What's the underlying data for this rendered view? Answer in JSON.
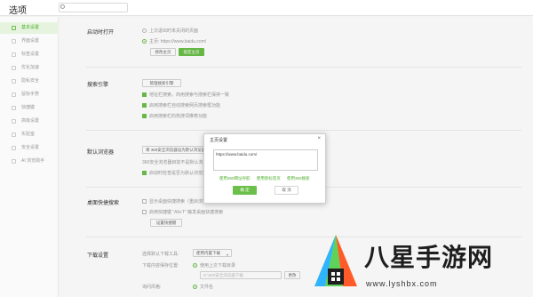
{
  "header": {
    "title": "选项",
    "search_placeholder": ""
  },
  "sidebar": {
    "items": [
      {
        "label": "基本设置"
      },
      {
        "label": "界面设置"
      },
      {
        "label": "标签设置"
      },
      {
        "label": "优化加速"
      },
      {
        "label": "隐私安全"
      },
      {
        "label": "鼠标手势"
      },
      {
        "label": "快捷键"
      },
      {
        "label": "高级设置"
      },
      {
        "label": "实验室"
      },
      {
        "label": "安全设置"
      },
      {
        "label": "AI 浏览助手"
      }
    ]
  },
  "startup": {
    "label": "启动时打开",
    "option1": "上次退出时未关闭的页面",
    "option2": "主页: https://www.baidu.com/",
    "btn_modify": "修改主页",
    "btn_lock": "锁定主页"
  },
  "search": {
    "label": "搜索引擎",
    "btn_manage": "管理搜索引擎",
    "opt1": "地址栏搜索，商用搜索与搜索栏保持一致",
    "opt2": "启用搜索栏自动搜索网页搜索框功能",
    "opt3": "启用搜索栏的热搜词推荐功能"
  },
  "default_browser": {
    "label": "默认浏览器",
    "select": "将 360安全浏览器设为默认浏览器",
    "line1": "360安全浏览器目前不是默认浏览器",
    "line2": "启动时检查是否为默认浏览器"
  },
  "desktop_search": {
    "label": "桌面快捷搜索",
    "opt1": "显示桌面快捷搜索（重启浏览器后生效）",
    "opt2": "启用快捷键 \"Alt+T\" 触发桌面快捷搜索",
    "btn": "设置快捷键"
  },
  "download": {
    "label": "下载设置",
    "tool_label": "选择默认下载工具:",
    "tool_value": "使用内置下载",
    "dir_label": "下载内容保存位置:",
    "dir_option": "使用上次下载目录",
    "path_value": "D:\\360安全浏览器下载",
    "btn_change": "更改",
    "ask_label": "询问风格:",
    "ask_option": "文件名"
  },
  "dialog": {
    "title": "主页设置",
    "close": "×",
    "url": "https://www.baidu.com/",
    "link1": "使用360网址导航",
    "link2": "使用新标签页",
    "link3": "使用360搜索",
    "ok": "确 定",
    "cancel": "取 消"
  },
  "watermark": {
    "brand": "八星手游网",
    "url": "www.lyshbx.com"
  },
  "colors": {
    "accent": "#6cbf4a",
    "sidebar_active_bg": "#e6f4df"
  },
  "icons": {
    "search": "search-icon",
    "close": "close-icon",
    "caret": "chevron-down-icon"
  }
}
